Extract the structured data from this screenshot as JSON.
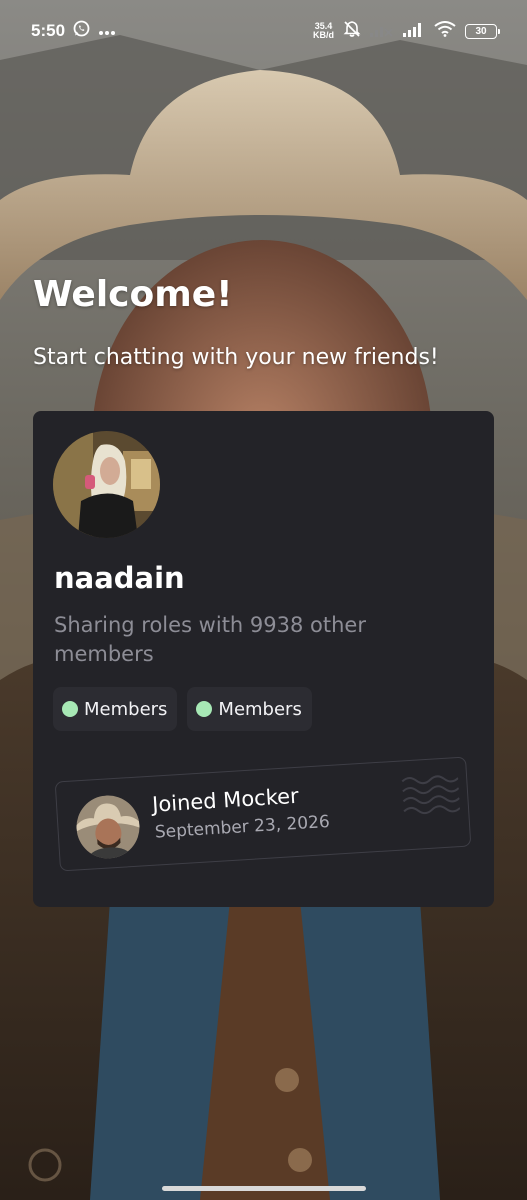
{
  "status_bar": {
    "time": "5:50",
    "net_speed_value": "35.4",
    "net_speed_unit": "KB/d",
    "battery": "30",
    "icons": [
      "whatsapp-icon",
      "more-dots-icon",
      "mute-icon",
      "signal-icon",
      "wifi-icon",
      "battery-icon"
    ]
  },
  "welcome": {
    "title": "Welcome!",
    "subtitle": "Start chatting with your new friends!"
  },
  "profile_card": {
    "username": "naadain",
    "sharing_text": "Sharing roles with 9938 other members",
    "roles": [
      {
        "label": "Members",
        "color": "#a7e8b5"
      },
      {
        "label": "Members",
        "color": "#a7e8b5"
      }
    ],
    "joined": {
      "title": "Joined Mocker",
      "date": "September 23, 2026"
    }
  },
  "colors": {
    "card_bg": "#232328",
    "pill_bg": "#2c2c32",
    "role_dot": "#a7e8b5",
    "muted_text": "#8d8d96"
  }
}
